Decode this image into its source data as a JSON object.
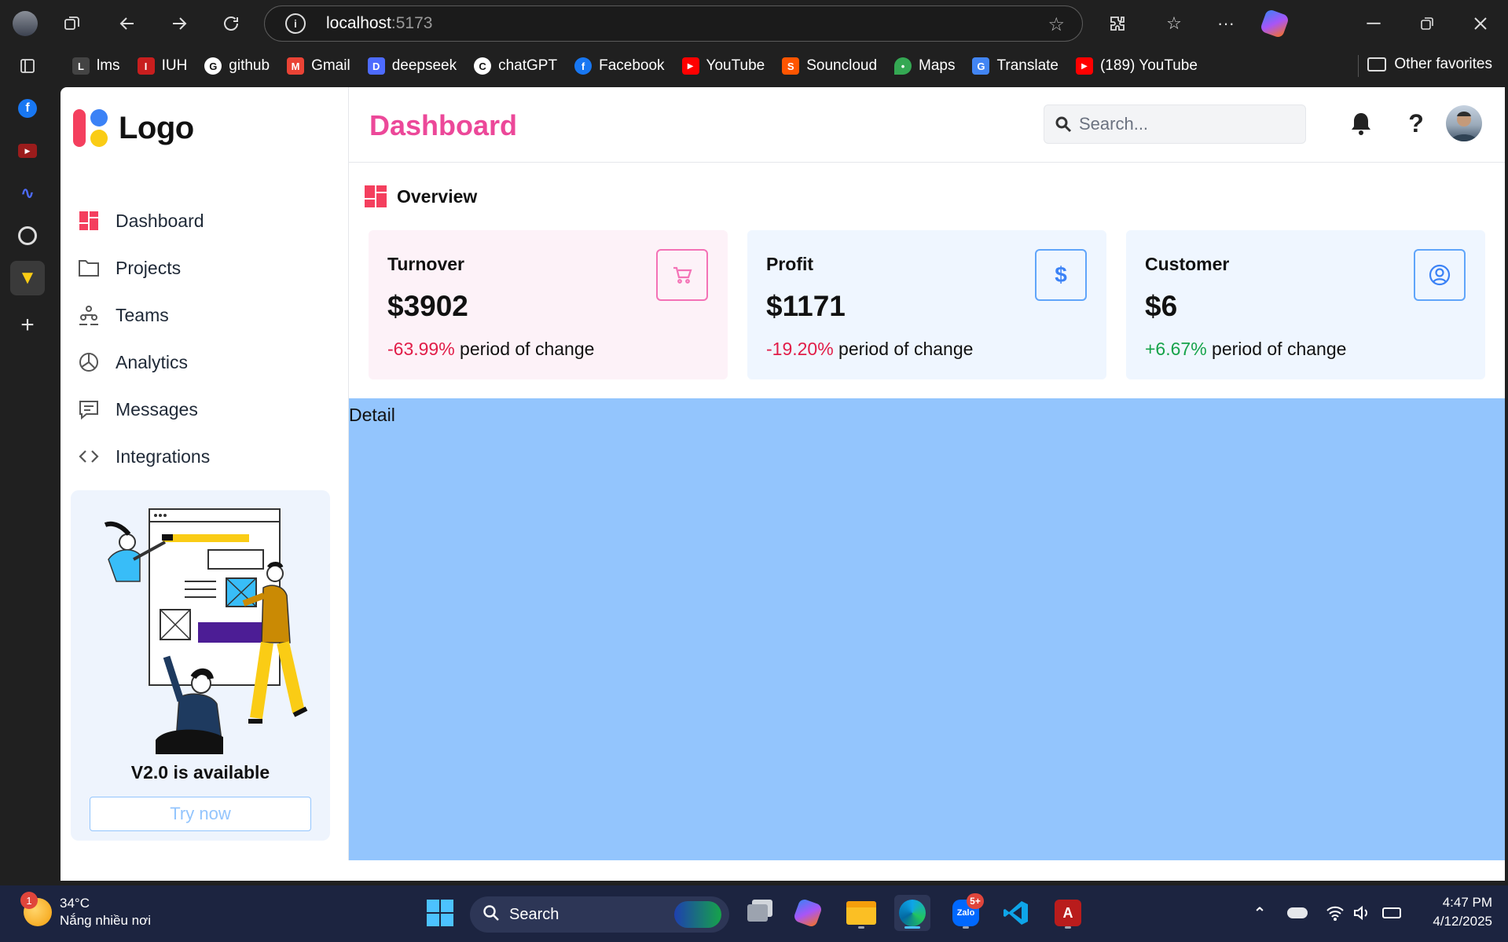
{
  "browser": {
    "url_host": "localhost",
    "url_port": ":5173",
    "bookmarks": [
      {
        "label": "lms",
        "color": "#444444",
        "glyph": "L"
      },
      {
        "label": "IUH",
        "color": "#c81e1e",
        "glyph": "I"
      },
      {
        "label": "github",
        "color": "#202020",
        "glyph": "G"
      },
      {
        "label": "Gmail",
        "color": "#ea4335",
        "glyph": "M"
      },
      {
        "label": "deepseek",
        "color": "#4d6bfe",
        "glyph": "D"
      },
      {
        "label": "chatGPT",
        "color": "#202020",
        "glyph": "C"
      },
      {
        "label": "Facebook",
        "color": "#1877f2",
        "glyph": "f"
      },
      {
        "label": "YouTube",
        "color": "#ff0000",
        "glyph": "▶"
      },
      {
        "label": "Souncloud",
        "color": "#ff5500",
        "glyph": "S"
      },
      {
        "label": "Maps",
        "color": "#34a853",
        "glyph": "M"
      },
      {
        "label": "Translate",
        "color": "#4285f4",
        "glyph": "G"
      },
      {
        "label": "(189) YouTube",
        "color": "#ff0000",
        "glyph": "▶"
      }
    ],
    "other_favorites": "Other favorites"
  },
  "app": {
    "logo_text": "Logo",
    "nav": [
      {
        "label": "Dashboard",
        "icon": "dashboard-icon"
      },
      {
        "label": "Projects",
        "icon": "folder-icon"
      },
      {
        "label": "Teams",
        "icon": "teams-icon"
      },
      {
        "label": "Analytics",
        "icon": "pie-chart-icon"
      },
      {
        "label": "Messages",
        "icon": "message-icon"
      },
      {
        "label": "Integrations",
        "icon": "code-icon"
      }
    ],
    "promo": {
      "title": "V2.0 is available",
      "button": "Try now"
    },
    "header": {
      "title": "Dashboard",
      "search_placeholder": "Search..."
    },
    "overview_title": "Overview",
    "cards": [
      {
        "title": "Turnover",
        "value": "$3902",
        "change": "-63.99%",
        "change_suffix": " period of change",
        "change_color": "#e11d48",
        "bg": "#fdf2f8",
        "accent": "#f472b6",
        "icon": "cart-icon"
      },
      {
        "title": "Profit",
        "value": "$1171",
        "change": "-19.20%",
        "change_suffix": " period of change",
        "change_color": "#e11d48",
        "bg": "#eff6ff",
        "accent": "#60a5fa",
        "icon": "dollar-icon"
      },
      {
        "title": "Customer",
        "value": "$6",
        "change": "+6.67%",
        "change_suffix": " period of change",
        "change_color": "#16a34a",
        "bg": "#eff6ff",
        "accent": "#60a5fa",
        "icon": "user-circle-icon"
      }
    ],
    "detail_label": "Detail"
  },
  "taskbar": {
    "weather_temp": "34°C",
    "weather_desc": "Nắng nhiều nơi",
    "weather_badge": "1",
    "search_label": "Search",
    "zalo_badge": "5+",
    "time": "4:47 PM",
    "date": "4/12/2025"
  }
}
